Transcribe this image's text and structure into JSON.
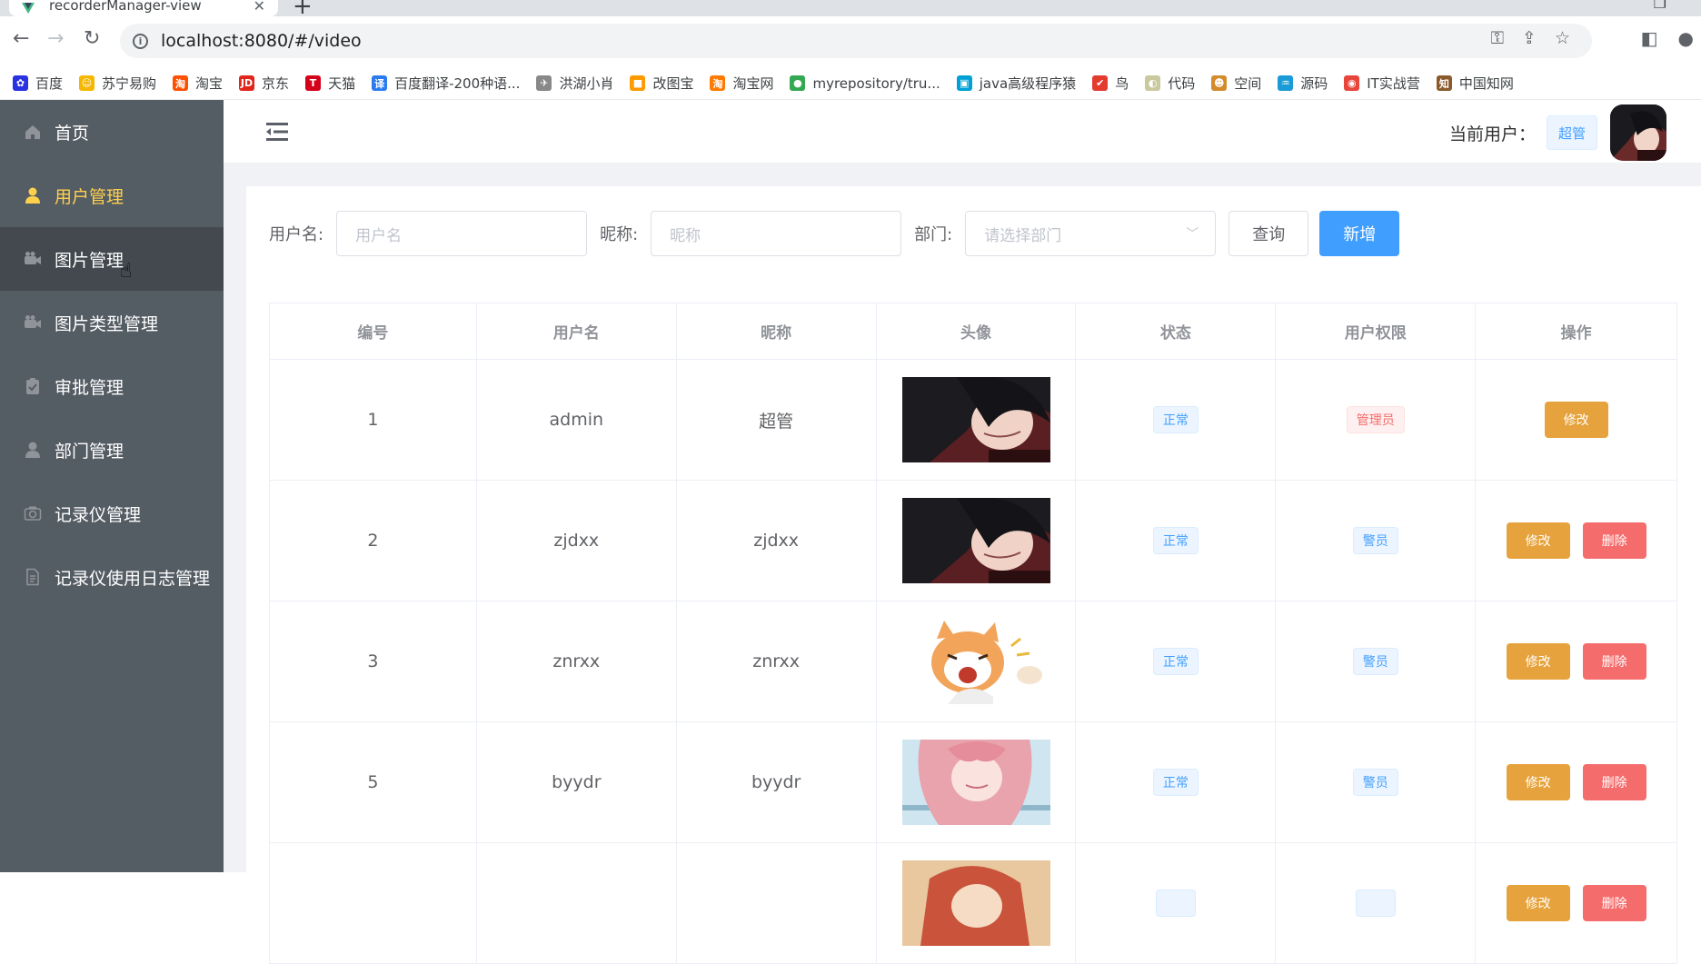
{
  "browser": {
    "tab_title": "recorderManager-view",
    "url": "localhost:8080/#/video",
    "bookmarks": [
      {
        "label": "百度",
        "color": "#2932e1",
        "glyph": "✿"
      },
      {
        "label": "苏宁易购",
        "color": "#f5b700",
        "glyph": "☺"
      },
      {
        "label": "淘宝",
        "color": "#ff5000",
        "glyph": "淘"
      },
      {
        "label": "京东",
        "color": "#e1251b",
        "glyph": "JD"
      },
      {
        "label": "天猫",
        "color": "#d4001a",
        "glyph": "T"
      },
      {
        "label": "百度翻译-200种语...",
        "color": "#2b7bf0",
        "glyph": "译"
      },
      {
        "label": "洪湖小肖",
        "color": "#888888",
        "glyph": "✈"
      },
      {
        "label": "改图宝",
        "color": "#ff9a00",
        "glyph": "■"
      },
      {
        "label": "淘宝网",
        "color": "#ff7a00",
        "glyph": "淘"
      },
      {
        "label": "myrepository/tru...",
        "color": "#34a853",
        "glyph": "●"
      },
      {
        "label": "java高级程序猿",
        "color": "#00a1d6",
        "glyph": "▣"
      },
      {
        "label": "鸟",
        "color": "#e33b2e",
        "glyph": "✔"
      },
      {
        "label": "代码",
        "color": "#c9c9a0",
        "glyph": "◐"
      },
      {
        "label": "空间",
        "color": "#d38b2c",
        "glyph": "☻"
      },
      {
        "label": "源码",
        "color": "#1a9bd7",
        "glyph": "♒"
      },
      {
        "label": "IT实战营",
        "color": "#e8453c",
        "glyph": "◉"
      },
      {
        "label": "中国知网",
        "color": "#8a5a2b",
        "glyph": "知"
      }
    ]
  },
  "sidebar": {
    "items": [
      {
        "label": "首页",
        "icon": "home-icon"
      },
      {
        "label": "用户管理",
        "icon": "user-icon"
      },
      {
        "label": "图片管理",
        "icon": "camera-icon"
      },
      {
        "label": "图片类型管理",
        "icon": "camera-icon"
      },
      {
        "label": "审批管理",
        "icon": "clipboard-check-icon"
      },
      {
        "label": "部门管理",
        "icon": "user-icon"
      },
      {
        "label": "记录仪管理",
        "icon": "camera-outline-icon"
      },
      {
        "label": "记录仪使用日志管理",
        "icon": "document-icon"
      }
    ],
    "active_color": "#ffd04b",
    "bg_color": "#545c64"
  },
  "header": {
    "current_user_label": "当前用户：",
    "current_user_tag": "超管"
  },
  "filter": {
    "username_label": "用户名:",
    "username_placeholder": "用户名",
    "nickname_label": "昵称:",
    "nickname_placeholder": "昵称",
    "dept_label": "部门:",
    "dept_placeholder": "请选择部门",
    "query_button": "查询",
    "add_button": "新增"
  },
  "table": {
    "headers": [
      "编号",
      "用户名",
      "昵称",
      "头像",
      "状态",
      "用户权限",
      "操作"
    ],
    "edit_label": "修改",
    "delete_label": "删除",
    "rows": [
      {
        "id": "1",
        "username": "admin",
        "nickname": "超管",
        "avatar": "dark-hair-anime",
        "status": "正常",
        "role": "管理员",
        "role_type": "red",
        "deletable": false
      },
      {
        "id": "2",
        "username": "zjdxx",
        "nickname": "zjdxx",
        "avatar": "dark-hair-anime",
        "status": "正常",
        "role": "警员",
        "role_type": "blue",
        "deletable": true
      },
      {
        "id": "3",
        "username": "znrxx",
        "nickname": "znrxx",
        "avatar": "cat-cartoon",
        "status": "正常",
        "role": "警员",
        "role_type": "blue",
        "deletable": true
      },
      {
        "id": "5",
        "username": "byydr",
        "nickname": "byydr",
        "avatar": "pink-hair-anime",
        "status": "正常",
        "role": "警员",
        "role_type": "blue",
        "deletable": true
      },
      {
        "id": "",
        "username": "",
        "nickname": "",
        "avatar": "warm-anime",
        "status": "",
        "role": "",
        "role_type": "blue",
        "deletable": true
      }
    ]
  }
}
